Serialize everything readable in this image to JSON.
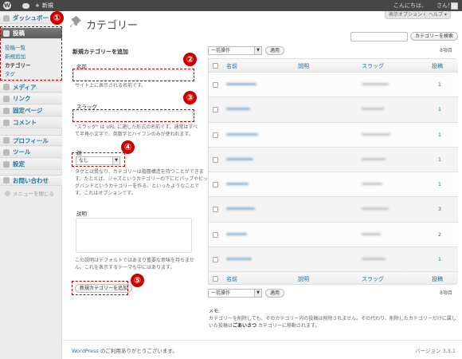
{
  "admin_bar": {
    "new_label": "新規",
    "greeting": "こんにちは、",
    "user_suffix": "さん！"
  },
  "sidebar": {
    "dashboard": "ダッシュボード",
    "posts": "投稿",
    "posts_sub": [
      "投稿一覧",
      "新規追加",
      "カテゴリー",
      "タグ"
    ],
    "media": "メディア",
    "links": "リンク",
    "pages": "固定ページ",
    "comments": "コメント",
    "profile": "プロフィール",
    "tools": "ツール",
    "settings": "設定",
    "contact": "お問い合わせ",
    "collapse": "メニューを閉じる"
  },
  "header": {
    "screen_options": "表示オプション ▾",
    "help": "ヘルプ ▾",
    "title": "カテゴリー"
  },
  "annotations": [
    "①",
    "②",
    "③",
    "④",
    "⑤"
  ],
  "form": {
    "heading": "新規カテゴリーを追加",
    "name_label": "名前",
    "name_value": "",
    "name_desc": "サイト上に表示される名前です。",
    "slug_label": "スラッグ",
    "slug_value": "",
    "slug_desc1": "\"スラッグ\" は URL に適した形式の名前です。通常はすべ",
    "slug_desc2": "て半角小文字で、英数字とハイフンのみが使われます。",
    "parent_label": "親",
    "parent_value": "なし",
    "parent_desc1": "タグとは異なり、カテゴリーは階層構造を持つことができま",
    "parent_desc2": "す。たとえば、ジャズというカテゴリーの下にビバップやビッ",
    "parent_desc3": "グバンドというカテゴリーを作る、といったようなことで",
    "parent_desc4": "す。これはオプションです。",
    "desc_label": "説明",
    "desc_value": "",
    "desc_desc1": "この説明はデフォルトではあまり重要な意味を持ちませ",
    "desc_desc2": "ん。これを表示するテーマも中にはあります。",
    "submit": "新規カテゴリーを追加"
  },
  "list": {
    "search_placeholder": "",
    "search_button": "カテゴリーを検索",
    "bulk_label": "一括操作",
    "apply": "適用",
    "item_count": "8項目",
    "columns": {
      "name": "名前",
      "desc": "説明",
      "slug": "スラッグ",
      "posts": "投稿"
    },
    "post_counts": [
      "1",
      "1",
      "1",
      "1",
      "1",
      "3",
      "2",
      "1"
    ]
  },
  "note": {
    "heading": "メモ:",
    "line1": "カテゴリーを削除しても、そのカテゴリー内の投稿は削除されません。その代わり、削除したカテゴリーだけに属して",
    "line2a": "いた投稿は",
    "line2b": "ごあいさつ",
    "line2c": " カテゴリーに移動されます。"
  },
  "footer": {
    "wp": "WordPress",
    "thanks": " のご利用ありがとうございます。",
    "version": "バージョン 3.3.1"
  }
}
